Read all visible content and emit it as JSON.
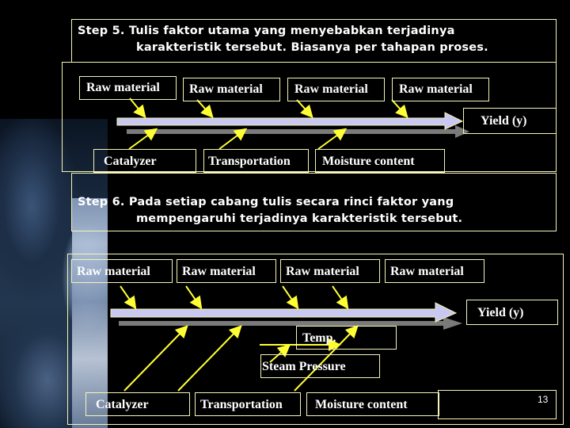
{
  "slide": {
    "page_number": "13",
    "step5": {
      "line1": "Step 5. Tulis faktor utama yang menyebabkan terjadinya",
      "line2": "karakteristik tersebut. Biasanya per tahapan proses."
    },
    "step6": {
      "line1": "Step 6. Pada setiap cabang tulis secara rinci faktor yang",
      "line2": "mempengaruhi terjadinya karakteristik tersebut."
    },
    "diagram1": {
      "top_causes": [
        "Raw material",
        "Raw material",
        "Raw material",
        "Raw material"
      ],
      "bottom_causes": [
        "Catalyzer",
        "Transportation",
        "Moisture content"
      ],
      "effect": "Yield (y)"
    },
    "diagram2": {
      "top_causes": [
        "Raw material",
        "Raw material",
        "Raw material",
        "Raw material"
      ],
      "bottom_causes": [
        "Catalyzer",
        "Transportation",
        "Moisture content"
      ],
      "sub_causes": [
        "Temp.",
        "Steam Pressure"
      ],
      "effect": "Yield (y)"
    },
    "colors": {
      "border": "#f5f5b8",
      "arrow_yellow": "#ffff33",
      "spine": "#c8c8f0",
      "spine_shadow": "#7a7a7a"
    }
  }
}
